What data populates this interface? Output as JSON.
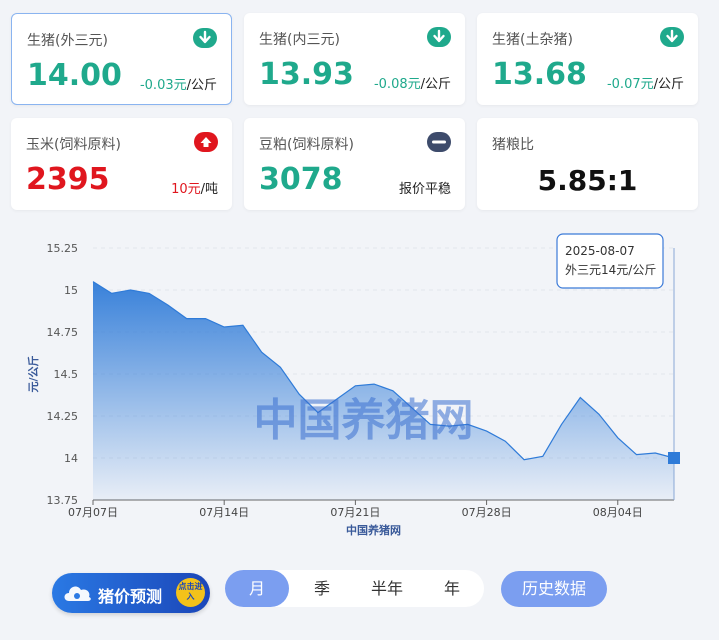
{
  "cards": [
    {
      "title": "生猪(外三元)",
      "value": "14.00",
      "change": "-0.03元",
      "unit": "/公斤",
      "trend": "down"
    },
    {
      "title": "生猪(内三元)",
      "value": "13.93",
      "change": "-0.08元",
      "unit": "/公斤",
      "trend": "down"
    },
    {
      "title": "生猪(土杂猪)",
      "value": "13.68",
      "change": "-0.07元",
      "unit": "/公斤",
      "trend": "down"
    },
    {
      "title": "玉米(饲料原料)",
      "value": "2395",
      "change": "10元",
      "unit": "/吨",
      "trend": "up"
    },
    {
      "title": "豆粕(饲料原料)",
      "value": "3078",
      "change": "报价平稳",
      "unit": "",
      "trend": "flat"
    },
    {
      "title": "猪粮比",
      "value": "5.85:1"
    }
  ],
  "colors": {
    "down": "#1fa98c",
    "up": "#e0161e",
    "flat": "#3d4b6b",
    "accent": "#7b9ef0",
    "series": "#2f7bd8"
  },
  "chart_data": {
    "type": "area",
    "ylabel": "元/公斤",
    "xlabel": "中国养猪网",
    "watermark": "中国养猪网",
    "ylim": [
      13.75,
      15.25
    ],
    "yticks": [
      "13.75",
      "14",
      "14.25",
      "14.5",
      "14.75",
      "15",
      "15.25"
    ],
    "xticks": [
      "07月07日",
      "07月14日",
      "07月21日",
      "07月28日",
      "08月04日"
    ],
    "x": [
      "07-07",
      "07-08",
      "07-09",
      "07-10",
      "07-11",
      "07-12",
      "07-13",
      "07-14",
      "07-15",
      "07-16",
      "07-17",
      "07-18",
      "07-19",
      "07-20",
      "07-21",
      "07-22",
      "07-23",
      "07-24",
      "07-25",
      "07-26",
      "07-27",
      "07-28",
      "07-29",
      "07-30",
      "07-31",
      "08-01",
      "08-02",
      "08-03",
      "08-04",
      "08-05",
      "08-06",
      "08-07"
    ],
    "series": [
      {
        "values": [
          15.05,
          14.98,
          15.0,
          14.98,
          14.91,
          14.83,
          14.83,
          14.78,
          14.79,
          14.63,
          14.54,
          14.38,
          14.27,
          14.35,
          14.43,
          14.44,
          14.4,
          14.3,
          14.2,
          14.19,
          14.2,
          14.16,
          14.1,
          13.99,
          14.01,
          14.2,
          14.36,
          14.26,
          14.12,
          14.02,
          14.03,
          14.0
        ]
      }
    ],
    "tooltip": {
      "date": "2025-08-07",
      "text": "外三元14元/公斤"
    }
  },
  "controls": {
    "forecast_label": "猪价预测",
    "forecast_badge": "点击进入",
    "periods": [
      "月",
      "季",
      "半年",
      "年"
    ],
    "active_period": "月",
    "history_label": "历史数据"
  }
}
